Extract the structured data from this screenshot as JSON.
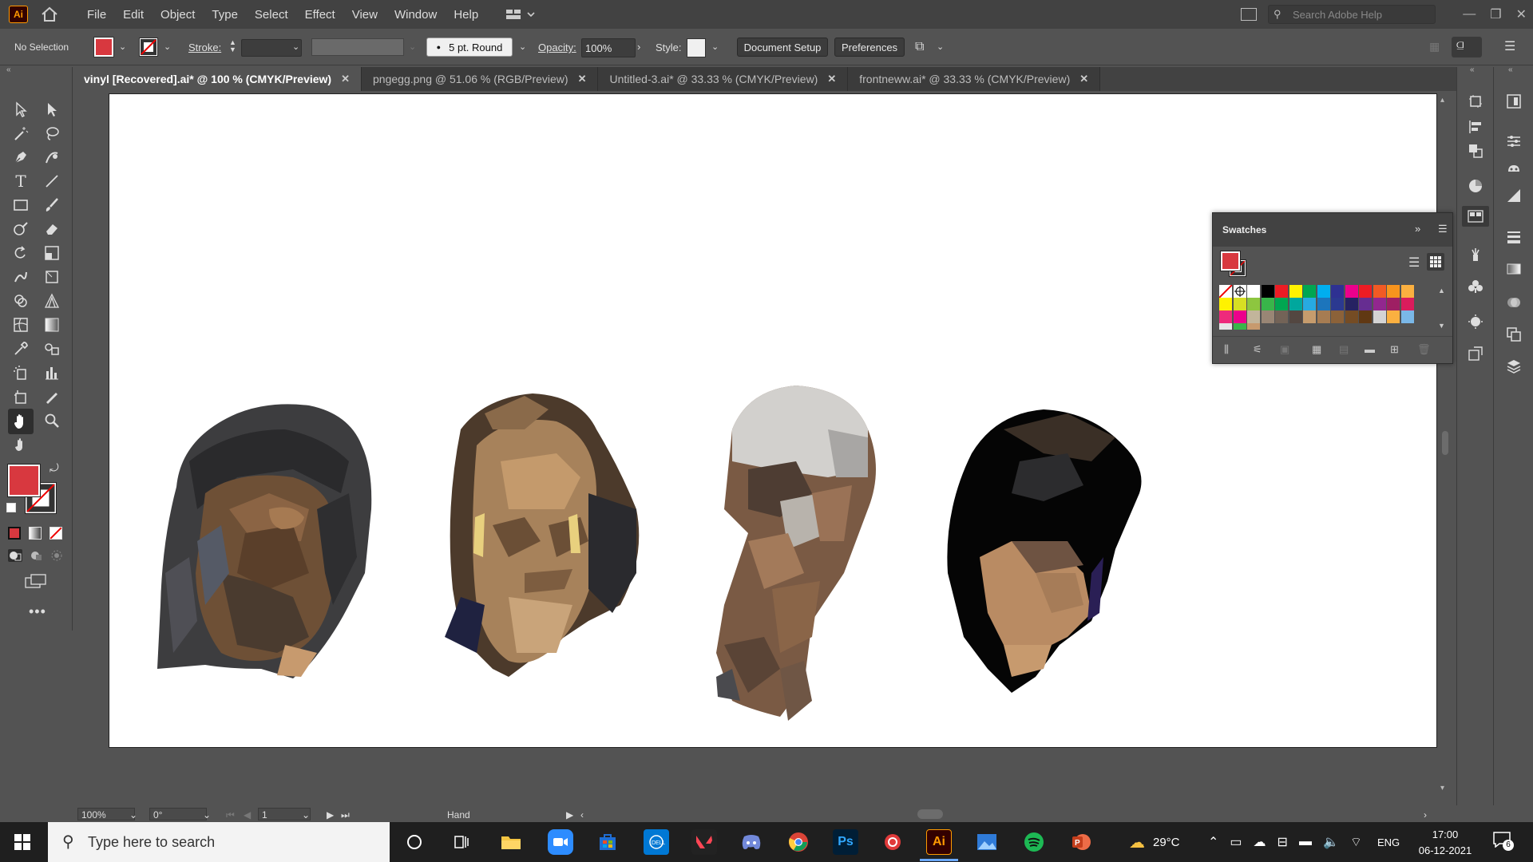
{
  "app": {
    "logo": "Ai"
  },
  "menubar": {
    "items": [
      "File",
      "Edit",
      "Object",
      "Type",
      "Select",
      "Effect",
      "View",
      "Window",
      "Help"
    ],
    "search_placeholder": "Search Adobe Help"
  },
  "control_bar": {
    "selection": "No Selection",
    "stroke_label": "Stroke:",
    "brush": "5 pt. Round",
    "opacity_label": "Opacity:",
    "opacity_value": "100%",
    "style_label": "Style:",
    "document_setup": "Document Setup",
    "preferences": "Preferences",
    "fill_color": "#d8383f"
  },
  "tabs": [
    {
      "label": "vinyl [Recovered].ai* @ 100 % (CMYK/Preview)",
      "active": true
    },
    {
      "label": "pngegg.png @ 51.06 % (RGB/Preview)",
      "active": false
    },
    {
      "label": "Untitled-3.ai* @ 33.33 % (CMYK/Preview)",
      "active": false
    },
    {
      "label": "frontneww.ai* @ 33.33 % (CMYK/Preview)",
      "active": false
    }
  ],
  "swatches_panel": {
    "title": "Swatches"
  },
  "status": {
    "zoom": "100%",
    "rotation": "0°",
    "artboard": "1",
    "tool": "Hand"
  },
  "taskbar": {
    "search_placeholder": "Type here to search",
    "weather": "29°C",
    "language": "ENG",
    "time": "17:00",
    "date": "06-12-2021",
    "notifications": "6"
  }
}
